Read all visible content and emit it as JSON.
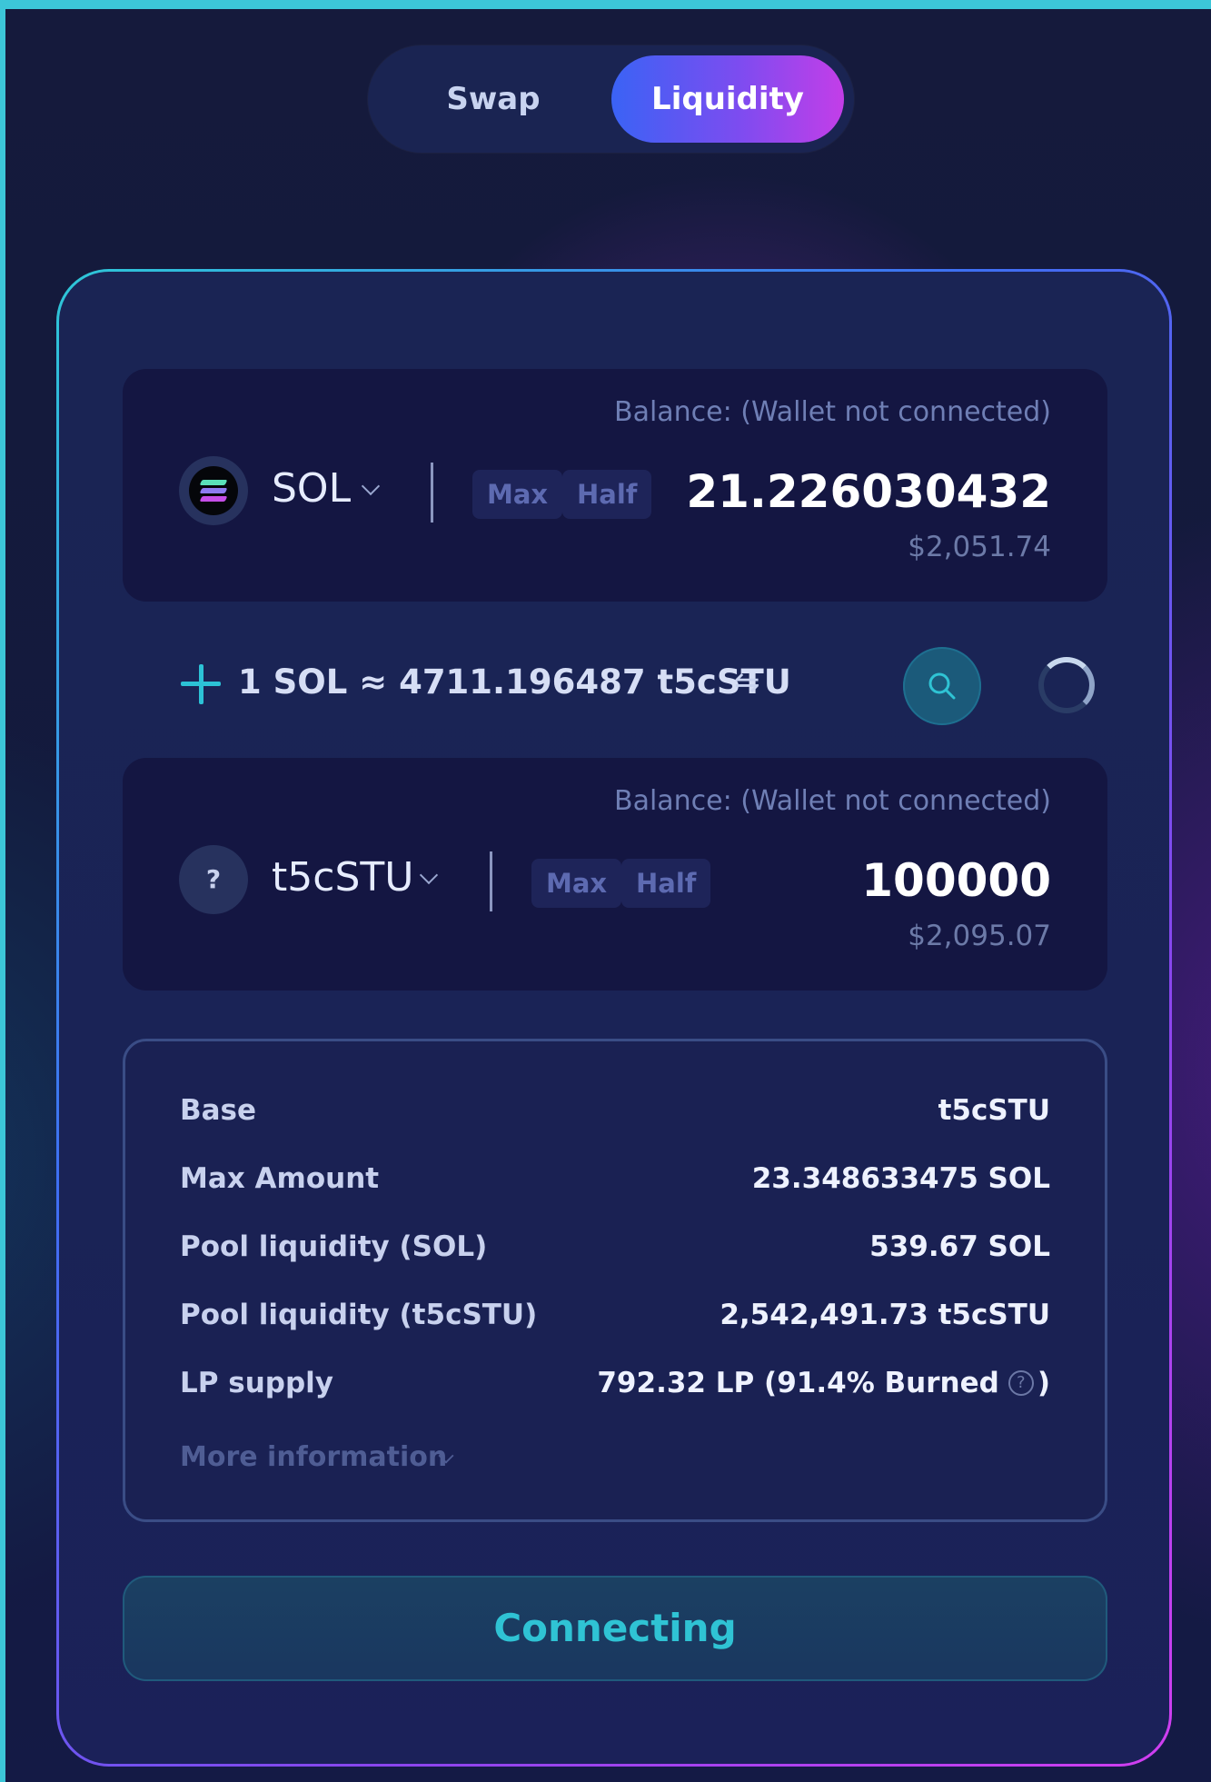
{
  "tabs": [
    {
      "label": "Swap",
      "active": false
    },
    {
      "label": "Liquidity",
      "active": true
    }
  ],
  "colors": {
    "accent_cyan": "#2cc2d6",
    "accent_gradient_start": "#3a63f5",
    "accent_gradient_end": "#c33ee8",
    "panel_bg": "#141642",
    "card_bg": "#1a2454"
  },
  "token_a": {
    "balance_label": "Balance: (Wallet not connected)",
    "symbol": "SOL",
    "icon": "solana-logo",
    "max_label": "Max",
    "half_label": "Half",
    "amount": "21.226030432",
    "usd_value": "$2,051.74"
  },
  "rate": {
    "text": "1 SOL ≈ 4711.196487 t5cSTU",
    "swap_glyph": "⇋"
  },
  "token_b": {
    "balance_label": "Balance: (Wallet not connected)",
    "symbol": "t5cSTU",
    "icon": "unknown-token",
    "icon_glyph": "?",
    "max_label": "Max",
    "half_label": "Half",
    "amount": "100000",
    "usd_value": "$2,095.07"
  },
  "info": {
    "rows": [
      {
        "label": "Base",
        "value": "t5cSTU"
      },
      {
        "label": "Max Amount",
        "value": "23.348633475 SOL"
      },
      {
        "label": "Pool liquidity (SOL)",
        "value": "539.67 SOL"
      },
      {
        "label": "Pool liquidity (t5cSTU)",
        "value": "2,542,491.73 t5cSTU"
      }
    ],
    "lp_supply": {
      "label": "LP supply",
      "value_prefix": "792.32 LP (91.4% Burned",
      "help_glyph": "?",
      "value_suffix": ")"
    },
    "more_label": "More information"
  },
  "action_button": {
    "label": "Connecting"
  }
}
